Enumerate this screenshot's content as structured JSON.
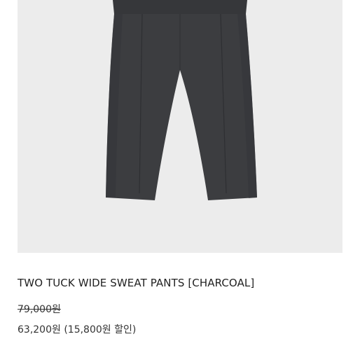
{
  "product": {
    "image_icon": "pants-photo",
    "name": "TWO TUCK WIDE SWEAT PANTS [CHARCOAL]",
    "original_price": "79,000원",
    "sale_price": "63,200원",
    "discount_text": "(15,800원 할인)",
    "colors": {
      "image_background": "#ececec",
      "garment": "#3c3d40"
    }
  }
}
